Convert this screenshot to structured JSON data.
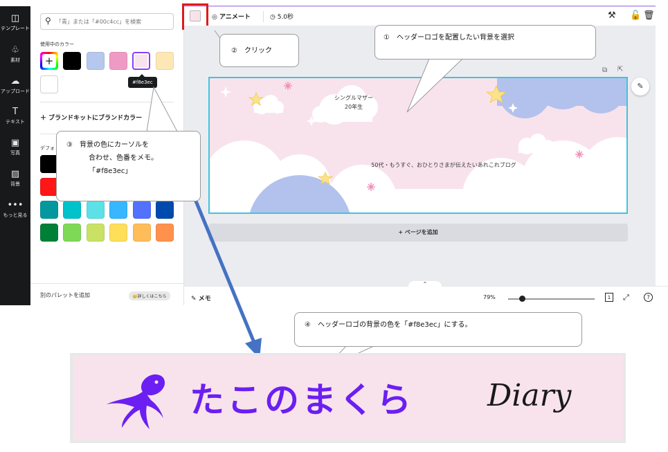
{
  "rail": {
    "items": [
      {
        "label": "テンプレート",
        "icon": "template-icon",
        "glyph": "◫"
      },
      {
        "label": "素材",
        "icon": "shapes-icon",
        "glyph": "♧"
      },
      {
        "label": "アップロード",
        "icon": "cloud-upload-icon",
        "glyph": "☁"
      },
      {
        "label": "テキスト",
        "icon": "text-icon",
        "glyph": "T"
      },
      {
        "label": "写真",
        "icon": "photo-icon",
        "glyph": "▣"
      },
      {
        "label": "背景",
        "icon": "background-icon",
        "glyph": "▨"
      },
      {
        "label": "もっと見る",
        "icon": "more-icon",
        "glyph": "•••"
      }
    ]
  },
  "panel": {
    "search_placeholder": "「青」または「#00c4cc」を検索",
    "in_use_title": "使用中のカラー",
    "in_use_colors": [
      "#000000",
      "#b6c8ee",
      "#ef9ac4",
      "#f8e3ec",
      "#fde7b4",
      "#ffffff"
    ],
    "tooltip": "#f8e3ec",
    "brandkit": "＋ ブランドキットにブランドカラー",
    "default_title": "デフォ",
    "default_rows": [
      [
        "#000000",
        "#545454",
        "#737373",
        "#a6a6a6",
        "#d9d9d9",
        "#ffffff"
      ],
      [
        "#ff1616",
        "#ff5757",
        "#ff66c4",
        "#cb6ce6",
        "#8c52ff",
        "#5e17eb"
      ],
      [
        "#03989e",
        "#00c2cb",
        "#5ce1e6",
        "#38b6ff",
        "#5271ff",
        "#004aad"
      ],
      [
        "#008037",
        "#7ed957",
        "#c9e265",
        "#ffde59",
        "#ffbd59",
        "#ff914d"
      ]
    ],
    "footer_add": "別のパレットを追加",
    "footer_badge": "詳しくはこちら"
  },
  "toolbar": {
    "bg_color": "#f8e3ec",
    "animate": "アニメート",
    "duration": "5.0秒"
  },
  "canvas": {
    "title_line1": "シングルマザー",
    "title_line2": "20年生",
    "subtitle": "50代・もうすぐ、おひとりさまが伝えたいあれこれブログ",
    "add_page": "+ ページを追加"
  },
  "bottom": {
    "memo": "メモ",
    "zoom": "79%",
    "zoom_fraction": 0.16,
    "page_count": "1"
  },
  "callouts": {
    "c1": "①　ヘッダーロゴを配置したい背景を選択",
    "c2": "②　クリック",
    "c3_line1": "③　背景の色にカーソルを",
    "c3_line2": "合わせ、色番をメモ。",
    "c3_line3": "「#f8e3ec」",
    "c4": "④　ヘッダーロゴの背景の色を「#f8e3ec」にする。"
  },
  "logo": {
    "bg": "#f8e3ec",
    "main": "たこのまくら",
    "script": "Diary",
    "color": "#6b1ff2"
  }
}
